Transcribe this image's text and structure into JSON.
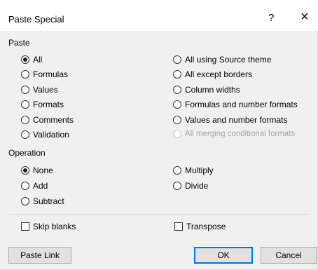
{
  "dialog": {
    "title": "Paste Special",
    "help_label": "?",
    "close_label": "×"
  },
  "paste": {
    "label": "Paste",
    "options_left": [
      {
        "label": "All",
        "checked": true
      },
      {
        "label": "Formulas",
        "checked": false
      },
      {
        "label": "Values",
        "checked": false
      },
      {
        "label": "Formats",
        "checked": false
      },
      {
        "label": "Comments",
        "checked": false
      },
      {
        "label": "Validation",
        "checked": false
      }
    ],
    "options_right": [
      {
        "label": "All using Source theme",
        "disabled": false
      },
      {
        "label": "All except borders",
        "disabled": false
      },
      {
        "label": "Column widths",
        "disabled": false
      },
      {
        "label": "Formulas and number formats",
        "disabled": false
      },
      {
        "label": "Values and number formats",
        "disabled": false
      },
      {
        "label": "All merging conditional formats",
        "disabled": true
      }
    ]
  },
  "operation": {
    "label": "Operation",
    "options": [
      {
        "label": "None",
        "checked": true
      },
      {
        "label": "Add",
        "checked": false
      },
      {
        "label": "Subtract",
        "checked": false
      },
      {
        "label": "Multiply",
        "checked": false
      },
      {
        "label": "Divide",
        "checked": false
      }
    ]
  },
  "checkboxes": {
    "skip_blanks": "Skip blanks",
    "transpose": "Transpose"
  },
  "buttons": {
    "paste_link": "Paste Link",
    "ok": "OK",
    "cancel": "Cancel"
  }
}
